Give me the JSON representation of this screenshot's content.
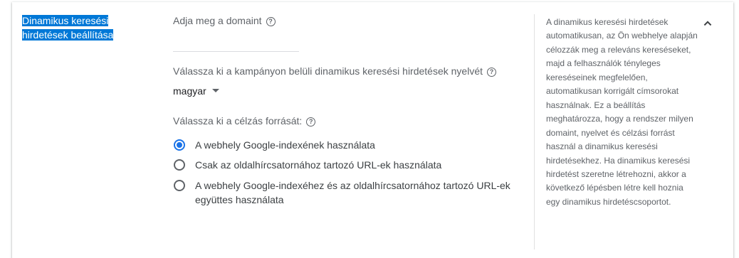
{
  "section": {
    "title": "Dinamikus keresési hirdetések beállítása"
  },
  "domain": {
    "label": "Adja meg a domaint",
    "value": "",
    "help_icon": "help-circle-icon"
  },
  "language": {
    "label": "Válassza ki a kampányon belüli dinamikus keresési hirdetések nyelvét",
    "selected": "magyar",
    "help_icon": "help-circle-icon"
  },
  "targeting_source": {
    "label": "Válassza ki a célzás forrását:",
    "help_icon": "help-circle-icon",
    "options": [
      {
        "label": "A webhely Google-indexének használata",
        "checked": true
      },
      {
        "label": "Csak az oldalhírcsatornához tartozó URL-ek használata",
        "checked": false
      },
      {
        "label": "A webhely Google-indexéhez és az oldalhírcsatornához tartozó URL-ek együttes használata",
        "checked": false
      }
    ]
  },
  "help_panel": {
    "text": "A dinamikus keresési hirdetések automatikusan, az Ön webhelye alapján célozzák meg a releváns kereséseket, majd a felhasználók tényleges kereséseinek megfelelően, automatikusan korrigált címsorokat használnak. Ez a beállítás meghatározza, hogy a rendszer milyen domaint, nyelvet és célzási forrást használ a dinamikus keresési hirdetésekhez. Ha dinamikus keresési hirdetést szeretne létrehozni, akkor a következő lépésben létre kell hoznia egy dinamikus hirdetéscsoportot."
  },
  "collapse_icon": "chevron-up-icon",
  "colors": {
    "accent": "#1a73e8",
    "selection_highlight": "#0078d7"
  }
}
